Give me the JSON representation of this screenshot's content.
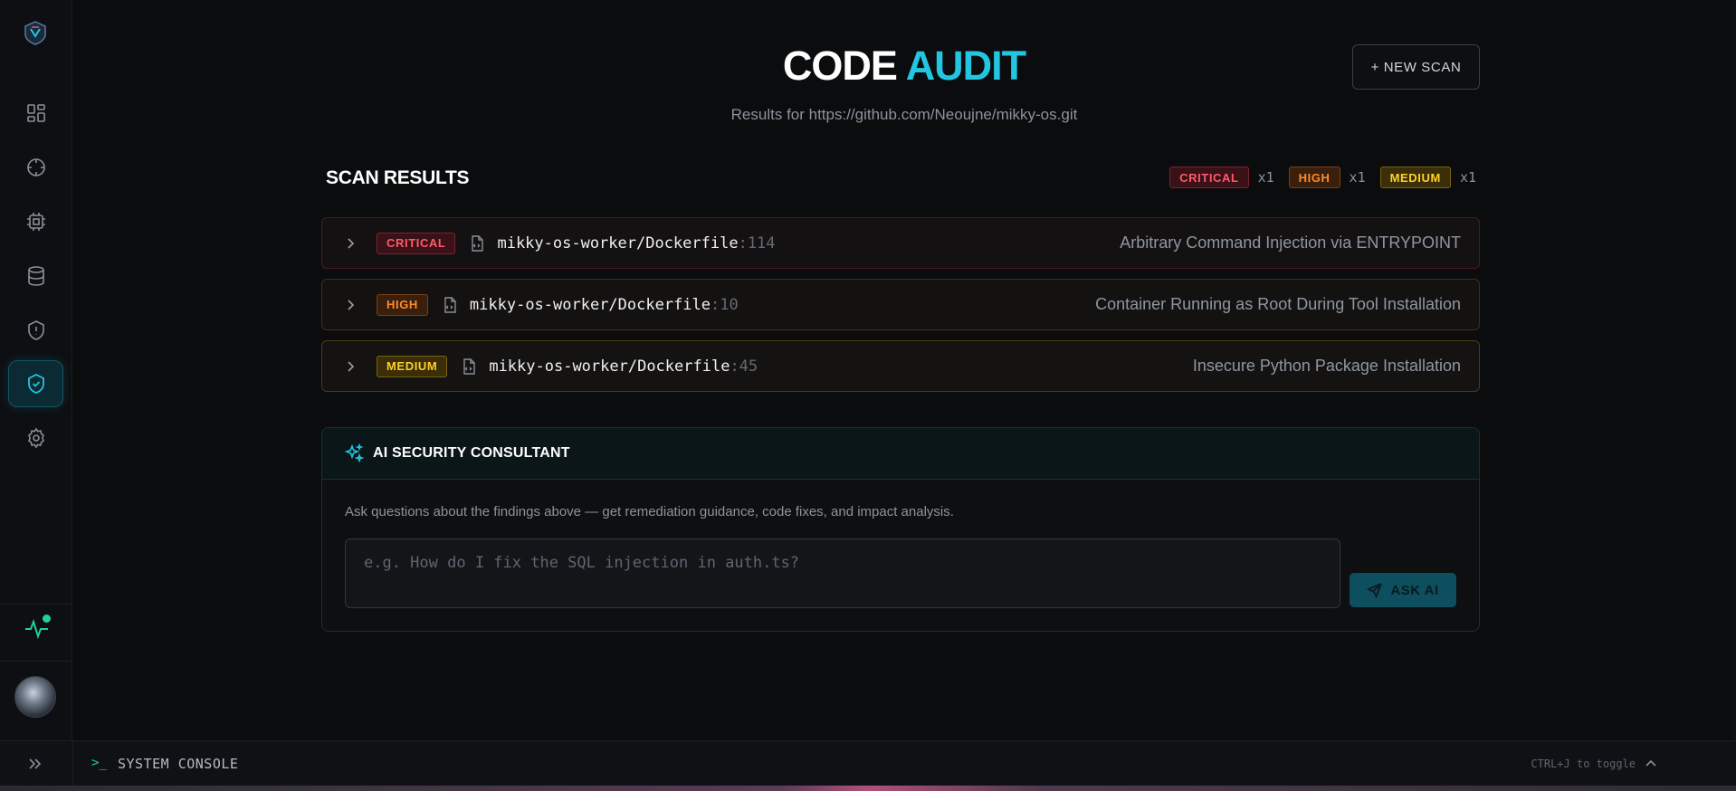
{
  "header": {
    "title_part1": "CODE",
    "title_part2": "AUDIT",
    "subtitle": "Results for https://github.com/Neoujne/mikky-os.git",
    "new_scan_label": "+ NEW SCAN"
  },
  "results": {
    "title": "SCAN RESULTS",
    "summary": [
      {
        "severity": "CRITICAL",
        "count": "x1"
      },
      {
        "severity": "HIGH",
        "count": "x1"
      },
      {
        "severity": "MEDIUM",
        "count": "x1"
      }
    ],
    "findings": [
      {
        "severity": "CRITICAL",
        "path": "mikky-os-worker/Dockerfile",
        "line": ":114",
        "title": "Arbitrary Command Injection via ENTRYPOINT"
      },
      {
        "severity": "HIGH",
        "path": "mikky-os-worker/Dockerfile",
        "line": ":10",
        "title": "Container Running as Root During Tool Installation"
      },
      {
        "severity": "MEDIUM",
        "path": "mikky-os-worker/Dockerfile",
        "line": ":45",
        "title": "Insecure Python Package Installation"
      }
    ]
  },
  "ai": {
    "title": "AI SECURITY CONSULTANT",
    "description": "Ask questions about the findings above — get remediation guidance, code fixes, and impact analysis.",
    "input_placeholder": "e.g. How do I fix the SQL injection in auth.ts?",
    "input_value": "",
    "ask_label": "ASK AI"
  },
  "console": {
    "prompt": ">_",
    "label": "SYSTEM CONSOLE",
    "hint": "CTRL+J to toggle"
  },
  "sidebar": {
    "items": [
      {
        "icon": "dashboard-icon",
        "active": false
      },
      {
        "icon": "crosshair-icon",
        "active": false
      },
      {
        "icon": "cpu-icon",
        "active": false
      },
      {
        "icon": "database-icon",
        "active": false
      },
      {
        "icon": "shield-alert-icon",
        "active": false
      },
      {
        "icon": "shield-check-icon",
        "active": true
      },
      {
        "icon": "settings-icon",
        "active": false
      }
    ],
    "status": "online"
  },
  "colors": {
    "accent": "#22c6e0",
    "critical": "#ff5a6a",
    "high": "#ff8a2a",
    "medium": "#ffcf2a",
    "status_online": "#1fd19a"
  }
}
